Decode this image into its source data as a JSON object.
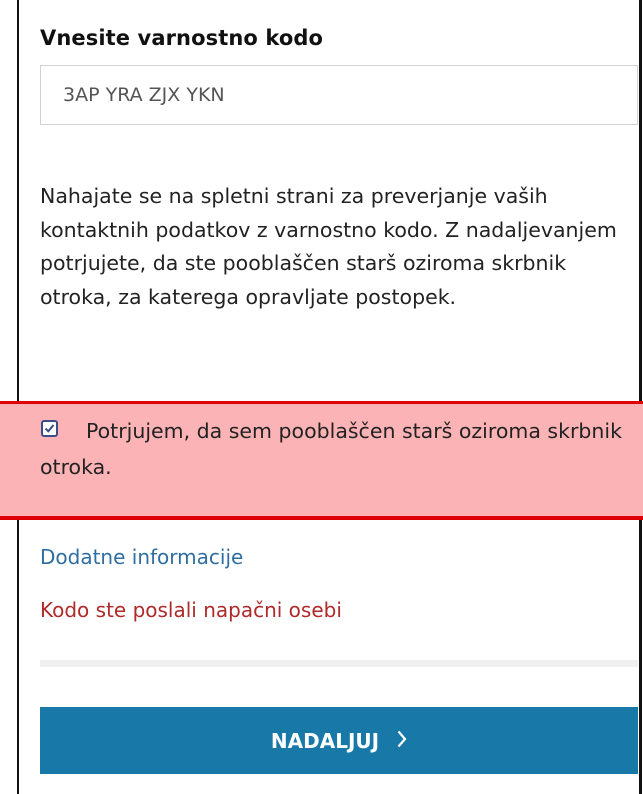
{
  "form": {
    "heading": "Vnesite varnostno kodo",
    "code_value": "3AP YRA ZJX YKN",
    "intro_text": "Nahajate se na spletni strani za preverjanje vaših kontaktnih podatkov z varnostno kodo. Z nadaljevanjem potrjujete, da ste pooblaščen starš oziroma skrbnik otroka, za katerega opravljate postopek.",
    "confirm_checked": true,
    "confirm_label": "Potrjujem, da sem pooblaščen starš oziroma skrbnik otroka.",
    "more_info_link": "Dodatne informacije",
    "wrong_person_link": "Kodo ste poslali napačni osebi",
    "continue_label": "NADALJUJ",
    "continue_icon": "chevron-right-icon"
  },
  "colors": {
    "highlight_band": "#fcb3b6",
    "highlight_border": "#e10000",
    "link_blue": "#2f6ea0",
    "link_red": "#b02a2a",
    "button_bg": "#1878a8"
  }
}
